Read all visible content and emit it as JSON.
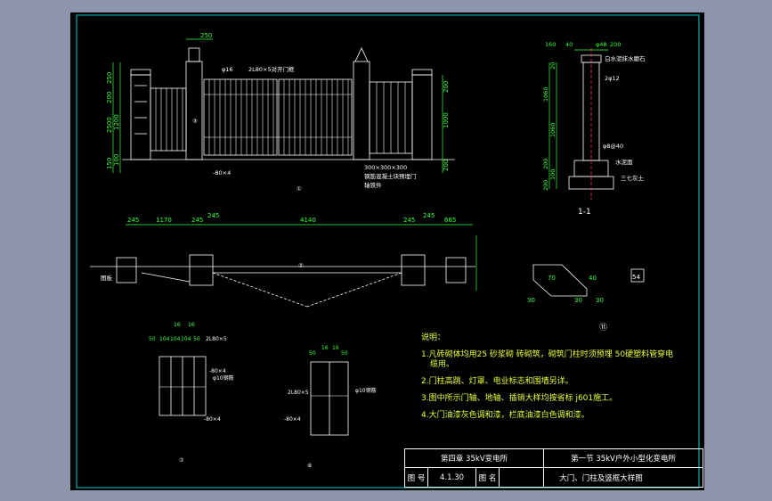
{
  "background_color": "#8d96ac",
  "sheet_color": "#000000",
  "line_colors": {
    "outline": "#ffffff",
    "dimension": "#39ff3a",
    "notes": "#e8ff33",
    "centerline": "#ff3344",
    "frame": "#00ffff"
  },
  "elevation": {
    "dims_top": [
      "250"
    ],
    "dims_left": [
      "250",
      "200",
      "1200",
      "2500",
      "100",
      "150"
    ],
    "dims_right": [
      "200",
      "1000",
      "200"
    ],
    "labels": [
      "φ16",
      "2L80×5对开门框",
      "③",
      "-80×4",
      "300×300×300",
      "钢筋混凝土块预埋门",
      "轴铁件",
      "①"
    ]
  },
  "section": {
    "title": "1-1",
    "dims_top": [
      "160",
      "40",
      "φ48",
      "200"
    ],
    "dims_left": [
      "20",
      "1060",
      "1060",
      "200",
      "100",
      "200"
    ],
    "labels": [
      "白水泥抹水磨石",
      "2φ12",
      "φ8@40",
      "水泥面",
      "三七灰土"
    ]
  },
  "plan": {
    "dims": [
      "245",
      "1170",
      "245",
      "245",
      "4140",
      "245",
      "245",
      "665"
    ],
    "labels": [
      "图板",
      "②"
    ]
  },
  "details": {
    "detail7": {
      "dims": [
        "50",
        "104",
        "104",
        "104",
        "50",
        "16",
        "16"
      ],
      "labels": [
        "2L80×5",
        "-80×4",
        "-80×4",
        "φ10钢筋",
        "⑦"
      ]
    },
    "detail8": {
      "dims": [
        "50",
        "16",
        "16",
        "50"
      ],
      "labels": [
        "2L80×5",
        "-80×4",
        "φ10钢筋",
        "⑧"
      ]
    },
    "detail11": {
      "dims": [
        "30",
        "70",
        "30",
        "40",
        "30",
        "54"
      ],
      "labels": [
        "⑪"
      ]
    }
  },
  "notes": {
    "title": "说明：",
    "items": [
      "1.凡砖砌体均用25 砂浆砌 砖砌筑，砌筑门柱时须预埋 50硬塑料管穿电",
      "  缆用。",
      "2.门柱高跳、灯罩、电业标志和围墙另详。",
      "3.图中所示门轴、地轴、插销大样均按省标 j601施工。",
      "4.大门油漆灰色调和漆，栏底油漆白色调和漆。"
    ]
  },
  "title_block": {
    "chapter": "第四章  35kV变电所",
    "section": "第一节  35kV户外小型化变电所",
    "drawing_no_label": "图 号",
    "drawing_no": "4.1.30",
    "drawing_name_label": "图 名",
    "drawing_name": "大门、门柱及竖框大样图"
  }
}
